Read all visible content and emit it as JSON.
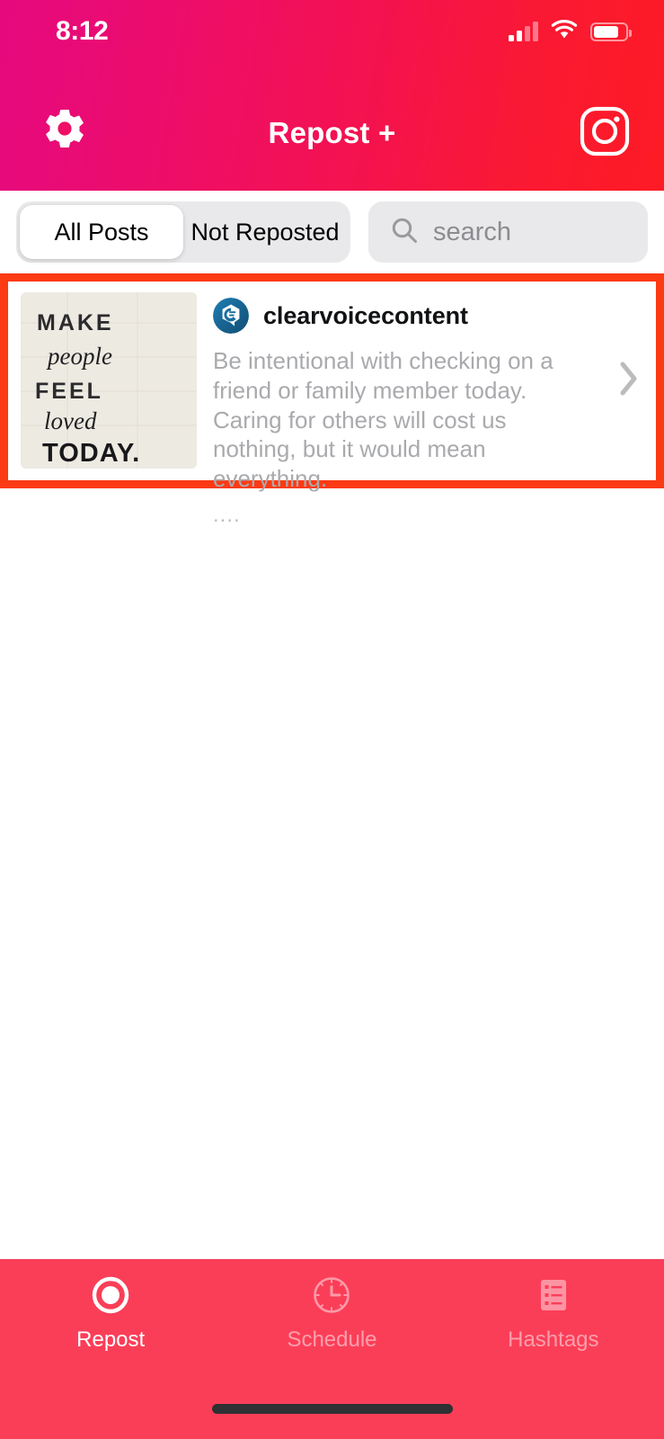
{
  "status_bar": {
    "time": "8:12",
    "signal_icon": "cellular-signal-icon",
    "wifi_icon": "wifi-icon",
    "battery_icon": "battery-icon",
    "signal_bars_filled": 2,
    "signal_bars_total": 4,
    "battery_level_percent": 78
  },
  "header": {
    "title": "Repost +",
    "settings_icon": "gear-icon",
    "instagram_icon": "instagram-icon",
    "gradient_start": "#e5097f",
    "gradient_end": "#fd1b25"
  },
  "filter_bar": {
    "segments": [
      {
        "label": "All Posts",
        "selected": true
      },
      {
        "label": "Not Reposted",
        "selected": false
      }
    ],
    "search": {
      "placeholder": "search",
      "value": "",
      "icon": "search-icon"
    },
    "track_color": "#e9e9eb"
  },
  "posts": [
    {
      "username": "clearvoicecontent",
      "caption": "Be intentional with checking on a friend or family member today. Caring for others will cost us nothing, but it would mean everything.",
      "more_indicator": "....",
      "thumbnail_alt": "MAKE people FEEL loved TODAY.",
      "thumbnail_lines": [
        "MAKE",
        "people",
        "FEEL",
        "loved",
        "TODAY."
      ],
      "avatar_icon": "clearvoice-logo-avatar",
      "chevron_icon": "chevron-right-icon",
      "highlighted": true,
      "highlight_color": "#fc3a13"
    }
  ],
  "tab_bar": {
    "background_color": "#fb3e58",
    "tabs": [
      {
        "label": "Repost",
        "icon": "repost-circle-icon",
        "active": true
      },
      {
        "label": "Schedule",
        "icon": "clock-icon",
        "active": false
      },
      {
        "label": "Hashtags",
        "icon": "list-icon",
        "active": false
      }
    ]
  },
  "home_indicator": "home-indicator"
}
